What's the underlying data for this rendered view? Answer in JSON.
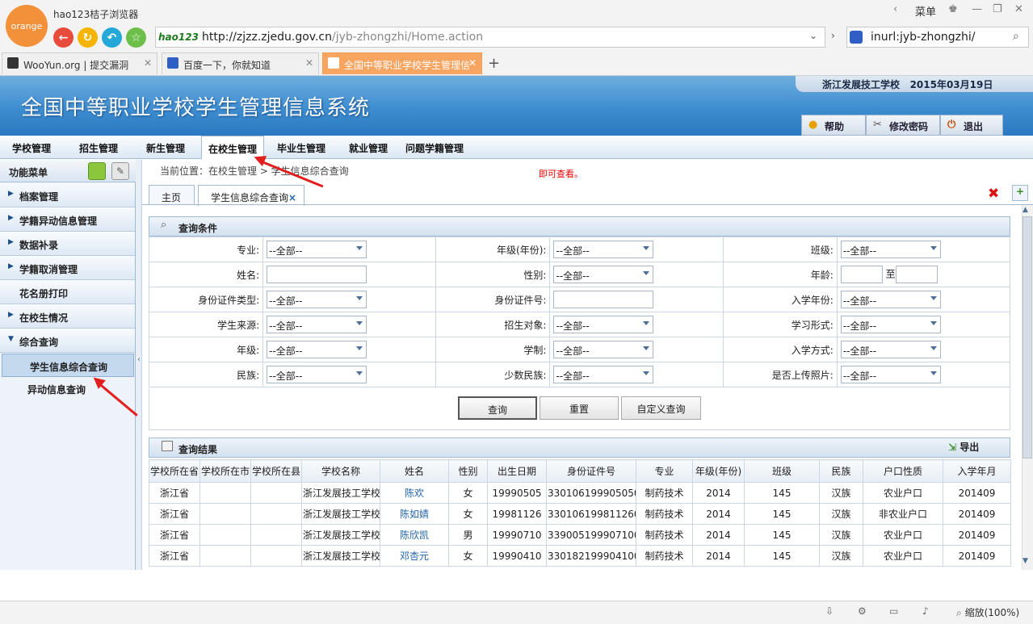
{
  "browser": {
    "name": "hao123桔子浏览器",
    "logo": "orange",
    "url_domain": "http://zjzz.zjedu.gov.cn",
    "url_path": "/jyb-zhongzhi/Home.action",
    "search": "inurl:jyb-zhongzhi/",
    "menu_label": "菜单",
    "brand": "hao123"
  },
  "tabs": [
    {
      "title": "WooYun.org | 提交漏洞"
    },
    {
      "title": "百度一下，你就知道"
    },
    {
      "title": "全国中等职业学校学生管理信"
    }
  ],
  "header": {
    "system_title": "全国中等职业学校学生管理信息系统",
    "school": "浙江发展技工学校",
    "date": "2015年03月19日",
    "help": "帮助",
    "change_password": "修改密码",
    "logout": "退出"
  },
  "menu": [
    "学校管理",
    "招生管理",
    "新生管理",
    "在校生管理",
    "毕业生管理",
    "就业管理",
    "问题学籍管理"
  ],
  "sidebar": {
    "title": "功能菜单",
    "items": [
      {
        "label": "档案管理"
      },
      {
        "label": "学籍异动信息管理"
      },
      {
        "label": "数据补录"
      },
      {
        "label": "学籍取消管理"
      },
      {
        "label": "花名册打印"
      },
      {
        "label": "在校生情况"
      },
      {
        "label": "综合查询"
      }
    ],
    "subitems": [
      {
        "label": "学生信息综合查询"
      },
      {
        "label": "异动信息查询"
      }
    ]
  },
  "breadcrumb": "当前位置：在校生管理 > 学生信息综合查询",
  "annotation": "即可查看。",
  "content_tabs": {
    "home": "主页",
    "current": "学生信息综合查询"
  },
  "query": {
    "title": "查询条件",
    "all": "--全部--",
    "to": "至",
    "labels": {
      "major": "专业:",
      "grade_year": "年级(年份):",
      "class": "班级:",
      "name": "姓名:",
      "gender": "性别:",
      "age": "年龄:",
      "id_type": "身份证件类型:",
      "id_no": "身份证件号:",
      "enroll_year": "入学年份:",
      "source": "学生来源:",
      "target": "招生对象:",
      "study_form": "学习形式:",
      "grade": "年级:",
      "duration": "学制:",
      "enroll_method": "入学方式:",
      "ethnic": "民族:",
      "minority": "少数民族:",
      "photo": "是否上传照片:"
    },
    "buttons": {
      "search": "查询",
      "reset": "重置",
      "custom": "自定义查询"
    }
  },
  "results": {
    "title": "查询结果",
    "export": "导出",
    "columns": [
      "学校所在省",
      "学校所在市",
      "学校所在县",
      "学校名称",
      "姓名",
      "性别",
      "出生日期",
      "身份证件号",
      "专业",
      "年级(年份)",
      "班级",
      "民族",
      "户口性质",
      "入学年月"
    ],
    "rows": [
      [
        "浙江省",
        "",
        "",
        "浙江发展技工学校",
        "陈欢",
        "女",
        "19990505",
        "330106199905050",
        "制药技术",
        "2014",
        "145",
        "汉族",
        "农业户口",
        "201409"
      ],
      [
        "浙江省",
        "",
        "",
        "浙江发展技工学校",
        "陈如婧",
        "女",
        "19981126",
        "330106199811260",
        "制药技术",
        "2014",
        "145",
        "汉族",
        "非农业户口",
        "201409"
      ],
      [
        "浙江省",
        "",
        "",
        "浙江发展技工学校",
        "陈欣凯",
        "男",
        "19990710",
        "339005199907100",
        "制药技术",
        "2014",
        "145",
        "汉族",
        "农业户口",
        "201409"
      ],
      [
        "浙江省",
        "",
        "",
        "浙江发展技工学校",
        "邓杏元",
        "女",
        "19990410",
        "330182199904100",
        "制药技术",
        "2014",
        "145",
        "汉族",
        "农业户口",
        "201409"
      ]
    ]
  },
  "status": {
    "zoom": "缩放(100%)"
  }
}
